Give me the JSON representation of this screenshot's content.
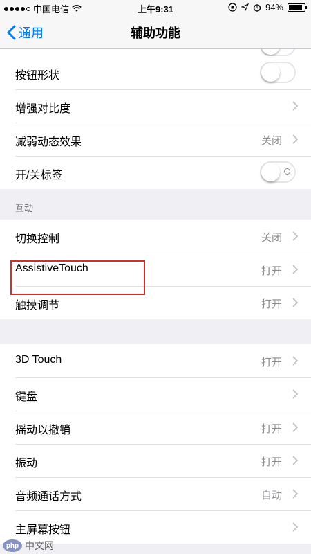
{
  "status_bar": {
    "carrier": "中国电信",
    "time": "上午9:31",
    "battery": "94%",
    "battery_level": 0.94
  },
  "nav": {
    "back_label": "通用",
    "title": "辅助功能"
  },
  "group1": [
    {
      "label": "按钮形状",
      "type": "toggle",
      "on": false
    },
    {
      "label": "增强对比度",
      "type": "link",
      "value": ""
    },
    {
      "label": "减弱动态效果",
      "type": "link",
      "value": "关闭"
    },
    {
      "label": "开/关标签",
      "type": "toggle",
      "on": false
    }
  ],
  "section_interaction": {
    "header": "互动",
    "rows": [
      {
        "label": "切换控制",
        "value": "关闭"
      },
      {
        "label": "AssistiveTouch",
        "value": "打开"
      },
      {
        "label": "触摸调节",
        "value": "打开"
      }
    ]
  },
  "group3": [
    {
      "label": "3D Touch",
      "value": "打开"
    },
    {
      "label": "键盘",
      "value": ""
    },
    {
      "label": "摇动以撤销",
      "value": "打开"
    },
    {
      "label": "振动",
      "value": "打开"
    },
    {
      "label": "音频通话方式",
      "value": "自动"
    },
    {
      "label": "主屏幕按钮",
      "value": ""
    }
  ],
  "watermark": {
    "logo": "php",
    "text": "中文网"
  },
  "colors": {
    "accent": "#007aff",
    "highlight": "#d32f2f",
    "background": "#efeff4"
  }
}
